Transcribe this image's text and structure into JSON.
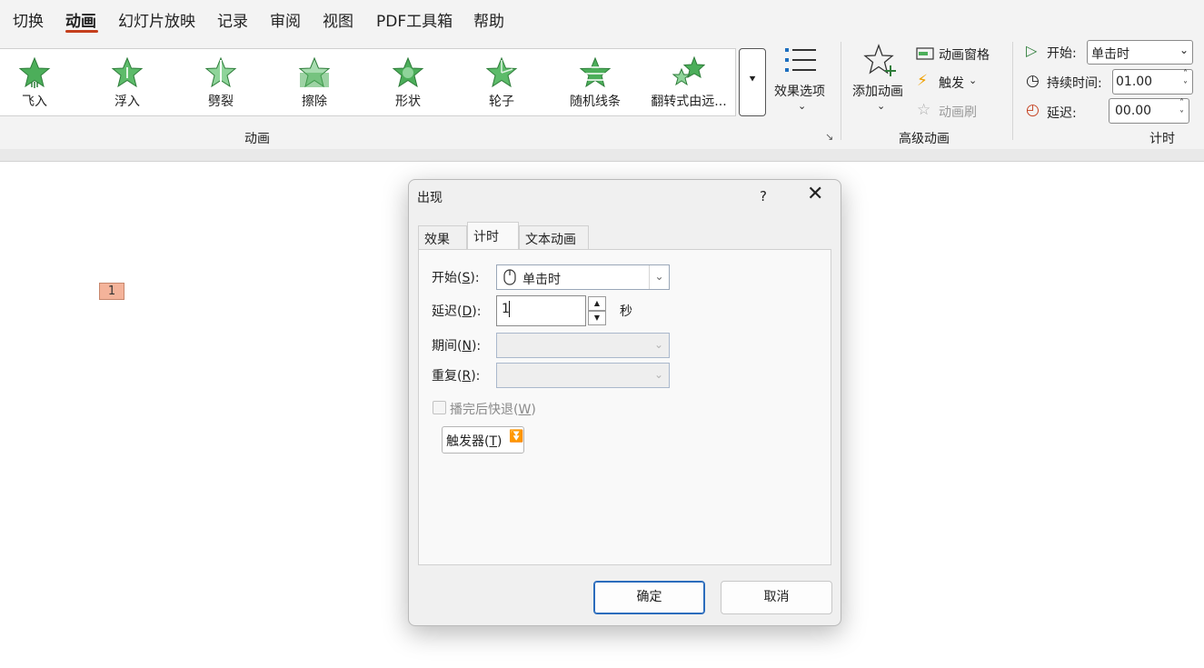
{
  "menu": {
    "tabs": [
      "切换",
      "动画",
      "幻灯片放映",
      "记录",
      "审阅",
      "视图",
      "PDF工具箱",
      "帮助"
    ],
    "active": "动画"
  },
  "ribbon": {
    "animations": [
      "飞入",
      "浮入",
      "劈裂",
      "擦除",
      "形状",
      "轮子",
      "随机线条",
      "翻转式由远..."
    ],
    "effect_options": "效果选项",
    "group_animation": "动画",
    "add_animation": "添加动画",
    "animation_pane": "动画窗格",
    "trigger": "触发",
    "animation_painter": "动画刷",
    "group_advanced": "高级动画",
    "start_label": "开始:",
    "start_value": "单击时",
    "duration_label": "持续时间:",
    "duration_value": "01.00",
    "delay_label": "延迟:",
    "delay_value": "00.00",
    "group_timing": "计时"
  },
  "slide": {
    "anim_tag": "1"
  },
  "dialog": {
    "title": "出现",
    "help": "?",
    "tabs": [
      "效果",
      "计时",
      "文本动画"
    ],
    "active_tab": "计时",
    "start_label": "开始(",
    "start_key": "S",
    "start_value": "单击时",
    "delay_label": "延迟(",
    "delay_key": "D",
    "delay_value": "1",
    "seconds": "秒",
    "period_label": "期间(",
    "period_key": "N",
    "repeat_label": "重复(",
    "repeat_key": "R",
    "rewind_label": "播完后快退(",
    "rewind_key": "W",
    "rewind_checked": false,
    "trigger_label": "触发器(",
    "trigger_key": "T",
    "ok": "确定",
    "cancel": "取消"
  },
  "colors": {
    "accent": "#c43e1c",
    "star_green": "#4cae5a",
    "primary_border": "#2b6cbc"
  }
}
